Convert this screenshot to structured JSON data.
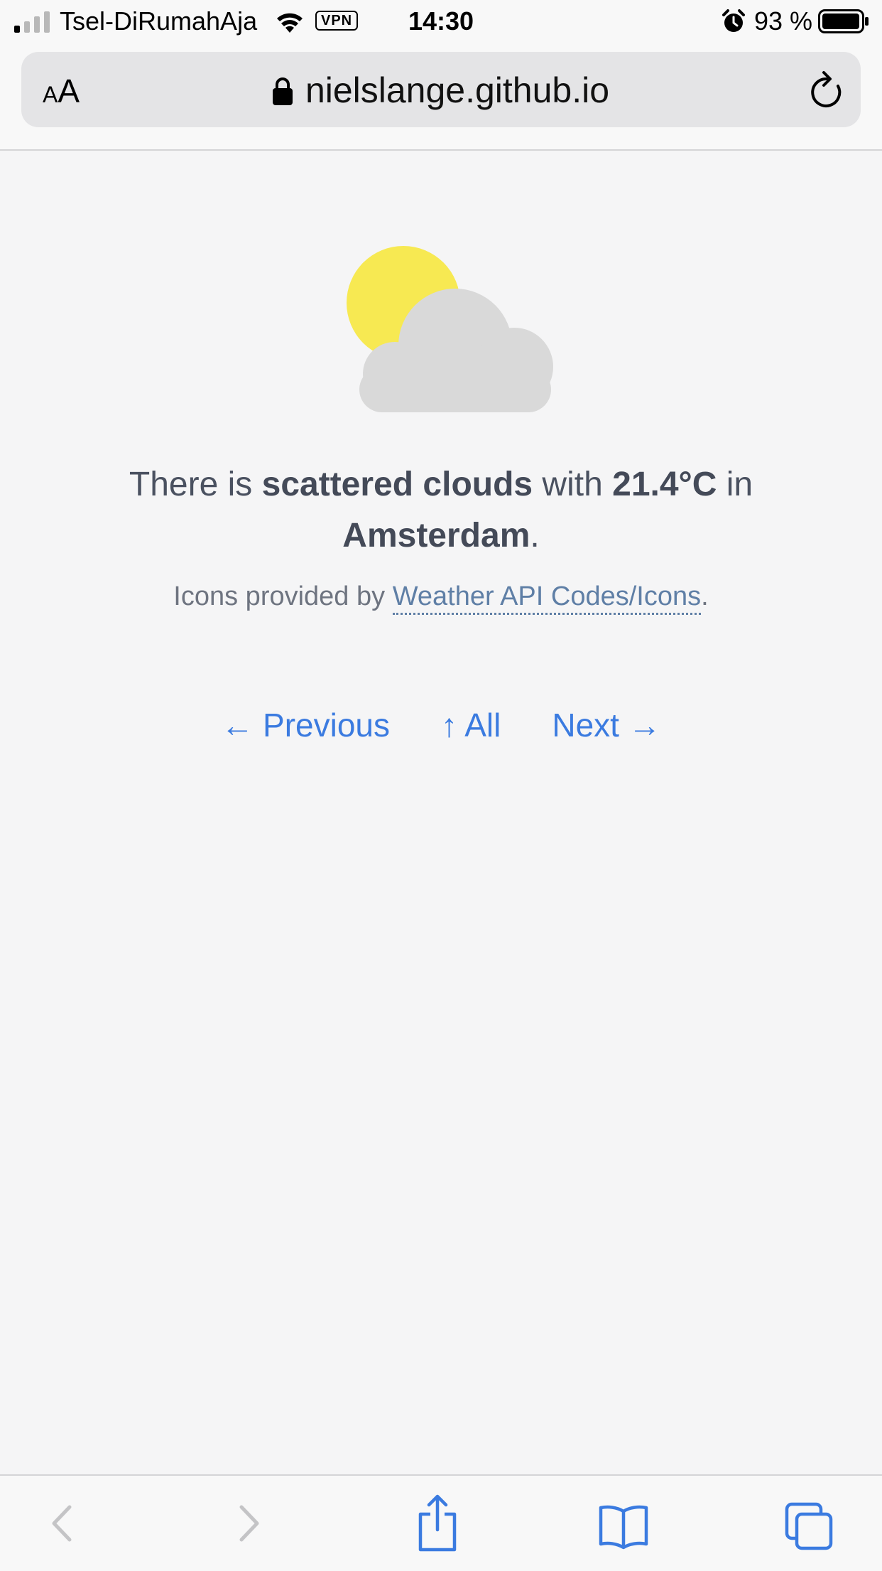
{
  "status_bar": {
    "carrier": "Tsel-DiRumahAja",
    "vpn": "VPN",
    "time": "14:30",
    "battery": "93 %"
  },
  "browser": {
    "text_size_small": "A",
    "text_size_large": "A",
    "url": "nielslange.github.io"
  },
  "weather": {
    "pre": "There is ",
    "condition": "scattered clouds",
    "mid": " with ",
    "temperature": "21.4°C",
    "post": " in ",
    "city": "Amsterdam",
    "end": "."
  },
  "credit": {
    "prefix": "Icons provided by ",
    "link": "Weather API Codes/Icons",
    "suffix": "."
  },
  "nav": {
    "previous": "← Previous",
    "all": "↑ All",
    "next": "Next →"
  },
  "icons": {
    "sun_color": "#f7e952",
    "cloud_color": "#d9d9d9",
    "link_color": "#3b7be0"
  }
}
